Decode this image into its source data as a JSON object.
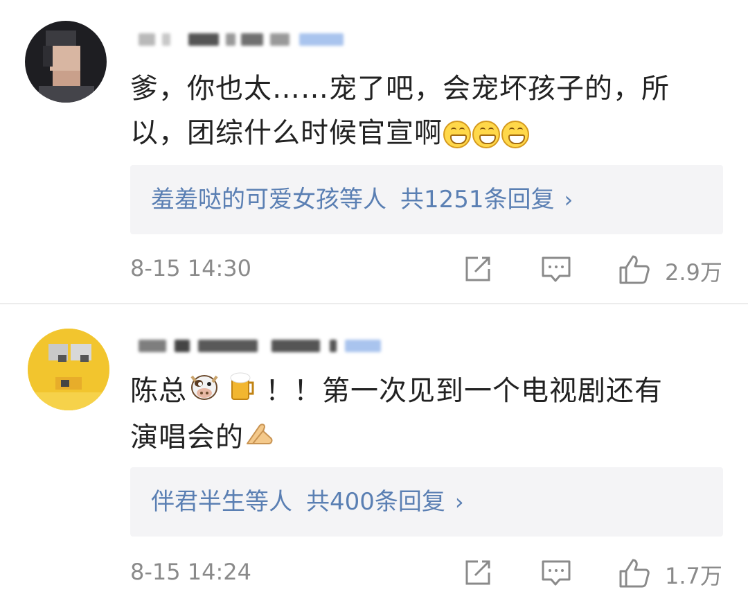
{
  "comments": [
    {
      "body_line1": "爹，你也太……宠了吧，会宠坏孩子的，所",
      "body_line2": "以，团综什么时候官宣啊",
      "emojis_after": [
        "grin-emoji",
        "grin-emoji",
        "grin-emoji"
      ],
      "replies": {
        "names": "羞羞哒的可爱女孩等人",
        "count_label": "共1251条回复",
        "chevron": "›"
      },
      "timestamp": "8-15 14:30",
      "likes": "2.9万",
      "icons": [
        "share-icon",
        "comment-icon",
        "like-icon"
      ]
    },
    {
      "body_line1_a": "陈总",
      "body_line1_b": "！！第一次见到一个电视剧还有",
      "body_line2": "演唱会的",
      "emojis_inline": [
        "cow-emoji",
        "beer-emoji"
      ],
      "emojis_after": [
        "folded-hands-emoji"
      ],
      "replies": {
        "names": "伴君半生等人",
        "count_label": "共400条回复",
        "chevron": "›"
      },
      "timestamp": "8-15 14:24",
      "likes": "1.7万",
      "icons": [
        "share-icon",
        "comment-icon",
        "like-icon"
      ]
    }
  ],
  "colors": {
    "link": "#5a7fb3",
    "meta": "#8a8a8a",
    "reply_bg": "#f4f4f6"
  }
}
